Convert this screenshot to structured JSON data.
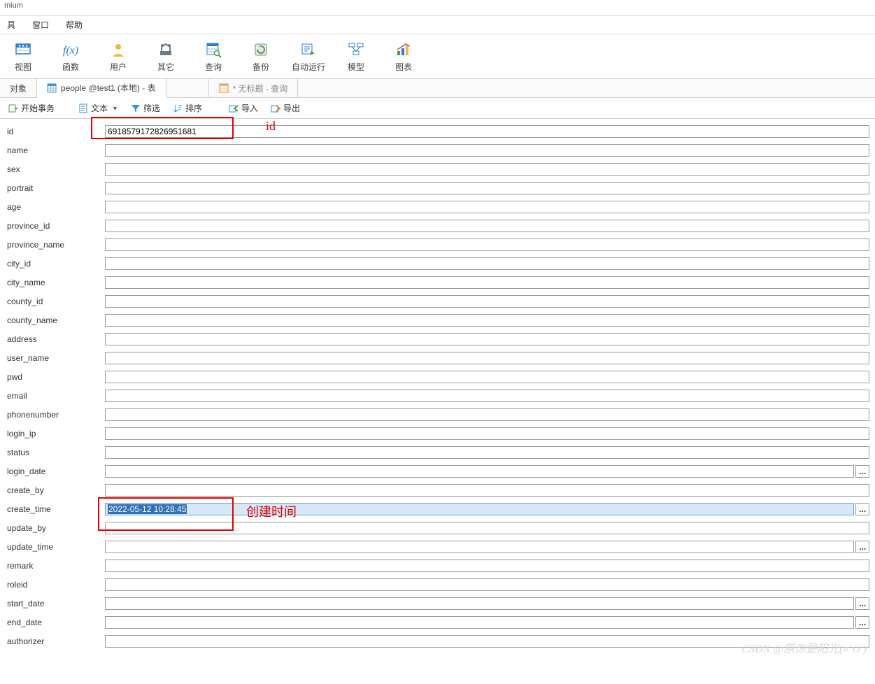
{
  "title": "mium",
  "menu": {
    "tools": "具",
    "window": "窗口",
    "help": "帮助"
  },
  "toolbar": [
    {
      "name": "view",
      "label": "视图"
    },
    {
      "name": "function",
      "label": "函数"
    },
    {
      "name": "user",
      "label": "用户"
    },
    {
      "name": "other",
      "label": "其它"
    },
    {
      "name": "query",
      "label": "查询"
    },
    {
      "name": "backup",
      "label": "备份"
    },
    {
      "name": "auto",
      "label": "自动运行"
    },
    {
      "name": "model",
      "label": "模型"
    },
    {
      "name": "chart",
      "label": "图表"
    }
  ],
  "tabs": {
    "objects": "对象",
    "table": "people @test1 (本地) - 表",
    "query": "* 无标题 - 查询"
  },
  "subtoolbar": {
    "begin": "开始事务",
    "text": "文本",
    "filter": "筛选",
    "sort": "排序",
    "import": "导入",
    "export": "导出"
  },
  "annotations": {
    "id": "id",
    "create": "创建时间"
  },
  "fields": [
    {
      "name": "id",
      "label": "id",
      "value": "6918579172826951681",
      "ellipsis": false,
      "highlight": "red"
    },
    {
      "name": "name",
      "label": "name",
      "value": "",
      "ellipsis": false
    },
    {
      "name": "sex",
      "label": "sex",
      "value": "",
      "ellipsis": false
    },
    {
      "name": "portrait",
      "label": "portrait",
      "value": "",
      "ellipsis": false
    },
    {
      "name": "age",
      "label": "age",
      "value": "",
      "ellipsis": false
    },
    {
      "name": "province_id",
      "label": "province_id",
      "value": "",
      "ellipsis": false
    },
    {
      "name": "province_name",
      "label": "province_name",
      "value": "",
      "ellipsis": false
    },
    {
      "name": "city_id",
      "label": "city_id",
      "value": "",
      "ellipsis": false
    },
    {
      "name": "city_name",
      "label": "city_name",
      "value": "",
      "ellipsis": false
    },
    {
      "name": "county_id",
      "label": "county_id",
      "value": "",
      "ellipsis": false
    },
    {
      "name": "county_name",
      "label": "county_name",
      "value": "",
      "ellipsis": false
    },
    {
      "name": "address",
      "label": "address",
      "value": "",
      "ellipsis": false
    },
    {
      "name": "user_name",
      "label": "user_name",
      "value": "",
      "ellipsis": false
    },
    {
      "name": "pwd",
      "label": "pwd",
      "value": "",
      "ellipsis": false
    },
    {
      "name": "email",
      "label": "email",
      "value": "",
      "ellipsis": false
    },
    {
      "name": "phonenumber",
      "label": "phonenumber",
      "value": "",
      "ellipsis": false
    },
    {
      "name": "login_ip",
      "label": "login_ip",
      "value": "",
      "ellipsis": false
    },
    {
      "name": "status",
      "label": "status",
      "value": "",
      "ellipsis": false
    },
    {
      "name": "login_date",
      "label": "login_date",
      "value": "",
      "ellipsis": true
    },
    {
      "name": "create_by",
      "label": "create_by",
      "value": "",
      "ellipsis": false
    },
    {
      "name": "create_time",
      "label": "create_time",
      "value": "2022-05-12 10:28:45",
      "ellipsis": true,
      "selected": true,
      "highlight": "red"
    },
    {
      "name": "update_by",
      "label": "update_by",
      "value": "",
      "ellipsis": false
    },
    {
      "name": "update_time",
      "label": "update_time",
      "value": "",
      "ellipsis": true
    },
    {
      "name": "remark",
      "label": "remark",
      "value": "",
      "ellipsis": false
    },
    {
      "name": "roleid",
      "label": "roleid",
      "value": "",
      "ellipsis": false
    },
    {
      "name": "start_date",
      "label": "start_date",
      "value": "",
      "ellipsis": true
    },
    {
      "name": "end_date",
      "label": "end_date",
      "value": "",
      "ellipsis": true
    },
    {
      "name": "authorizer",
      "label": "authorizer",
      "value": "",
      "ellipsis": false
    }
  ],
  "watermark": "CSDN @原你是阳光(#`O′)"
}
